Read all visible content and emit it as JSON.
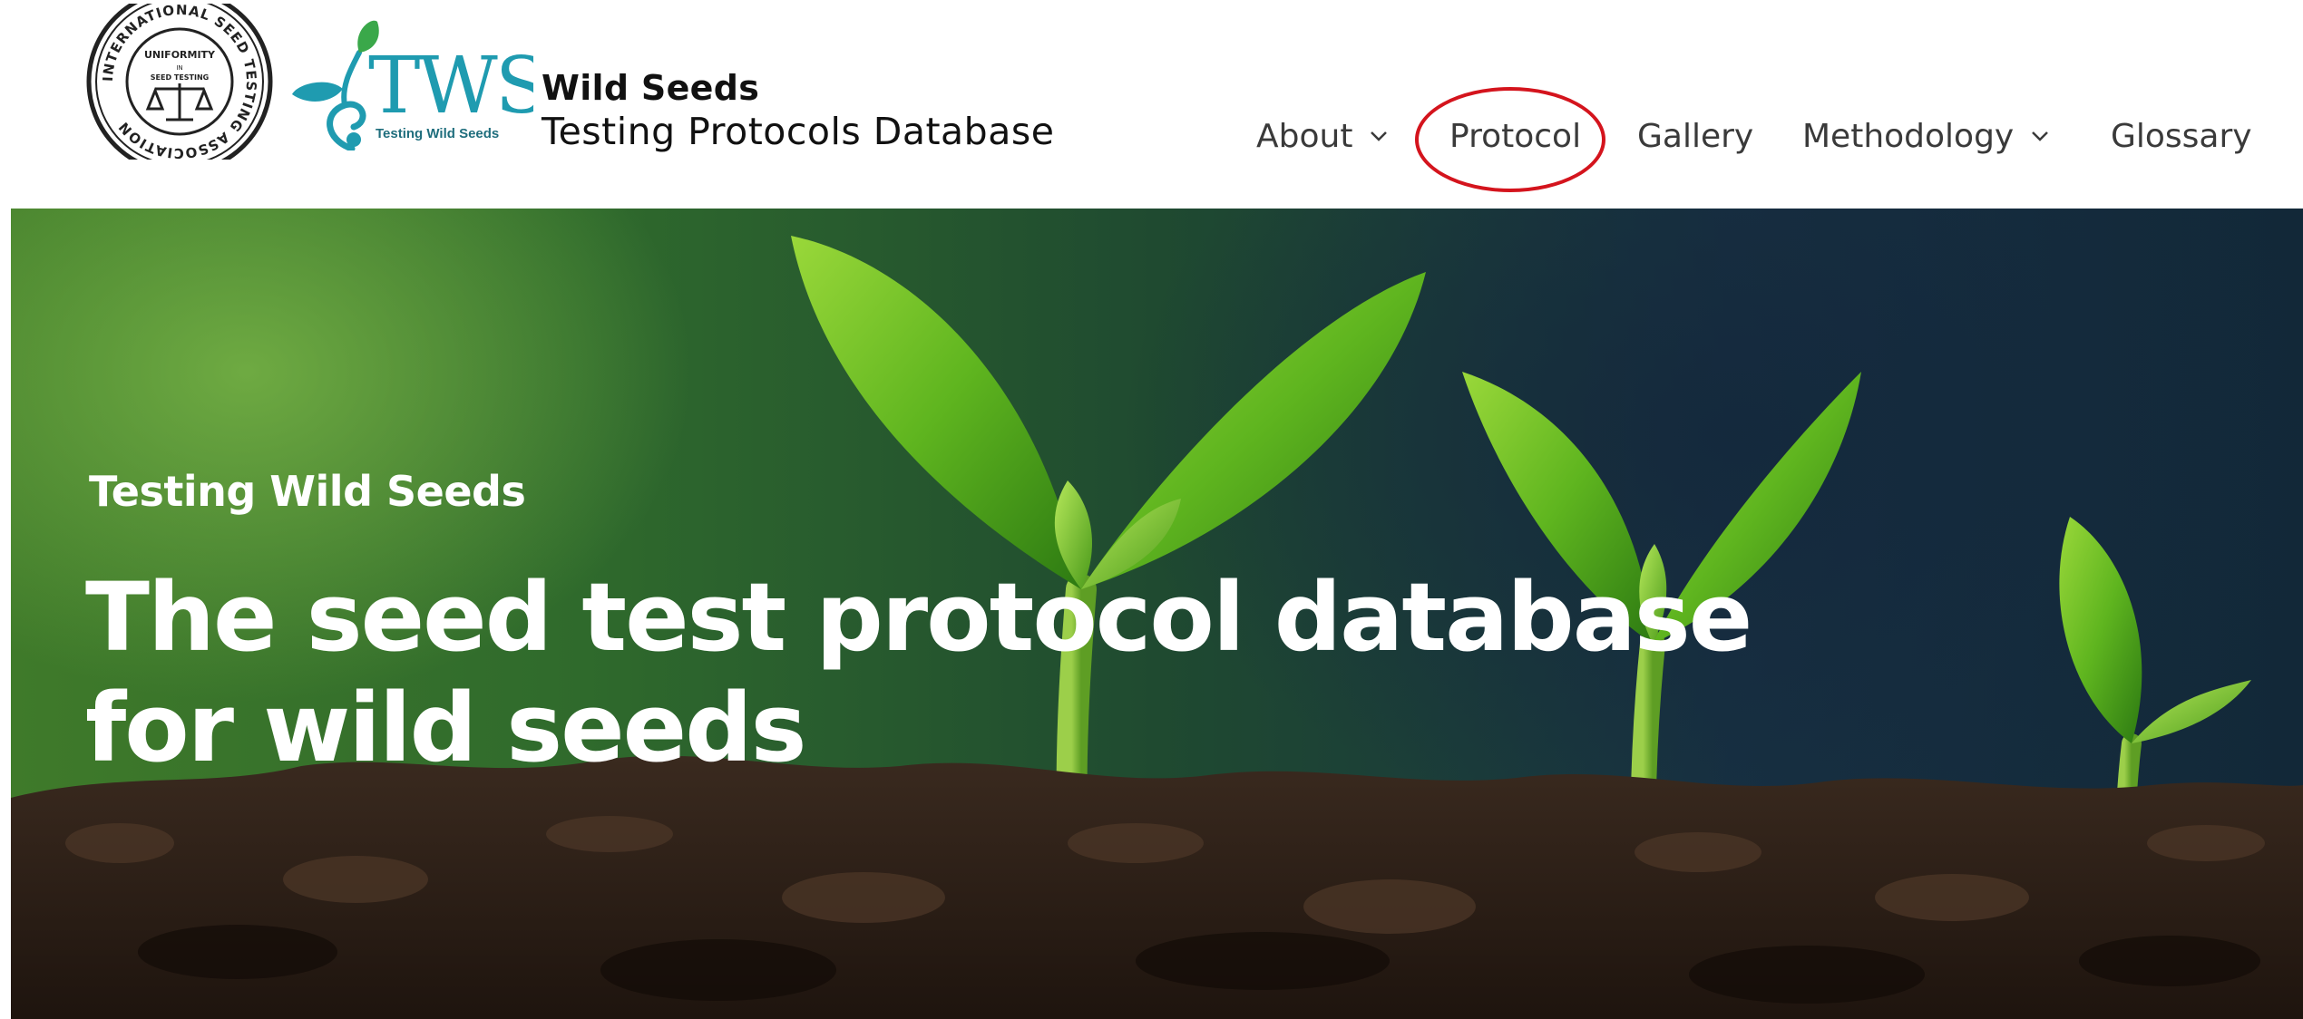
{
  "brand": {
    "seal_lines": [
      "INTERNATIONAL SEED TESTING ASSOCIATION",
      "UNIFORMITY",
      "IN",
      "SEED TESTING"
    ],
    "logo_letters": "TWS",
    "logo_caption": "Testing Wild Seeds",
    "title": "Wild Seeds",
    "subtitle": "Testing Protocols Database"
  },
  "nav": {
    "items": [
      {
        "label": "About",
        "has_dropdown": true
      },
      {
        "label": "Protocol",
        "has_dropdown": false,
        "highlighted": true
      },
      {
        "label": "Gallery",
        "has_dropdown": false
      },
      {
        "label": "Methodology",
        "has_dropdown": true
      },
      {
        "label": "Glossary",
        "has_dropdown": false
      }
    ]
  },
  "hero": {
    "eyebrow": "Testing Wild Seeds",
    "headline_line1": "The seed test protocol database",
    "headline_line2": "for wild seeds"
  },
  "colors": {
    "highlight": "#d4141d",
    "logo_teal": "#1f9bb0",
    "logo_green": "#3aa84a",
    "text_dark": "#111111",
    "nav_text": "#3a3a3a"
  },
  "icons": {
    "dropdown": "chevron-down-icon",
    "seal": "ista-seal-logo",
    "sprout": "tws-sprout-logo"
  }
}
